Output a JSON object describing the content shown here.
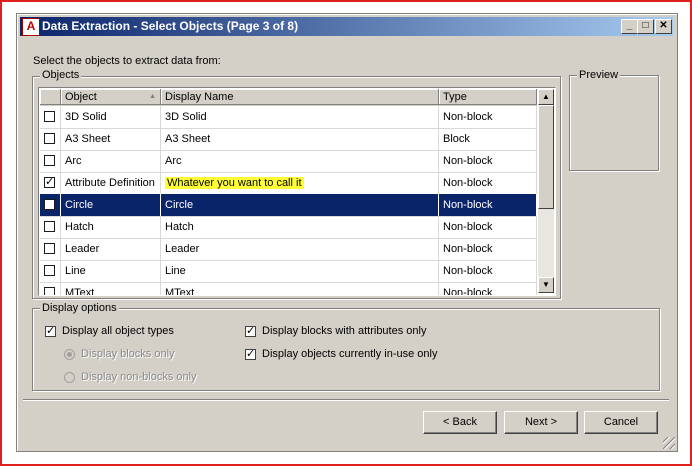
{
  "window": {
    "title": "Data Extraction - Select Objects (Page 3 of 8)",
    "app_icon": "A",
    "minimize_glyph": "_",
    "maximize_glyph": "□",
    "close_glyph": "✕"
  },
  "instruction": "Select the objects to extract data from:",
  "objects_group": {
    "legend": "Objects",
    "columns": [
      "Object",
      "Display Name",
      "Type"
    ],
    "sort_indicator": "▲",
    "rows": [
      {
        "checked": false,
        "object": "3D Solid",
        "display_name": "3D Solid",
        "type": "Non-block"
      },
      {
        "checked": false,
        "object": "A3 Sheet",
        "display_name": "A3 Sheet",
        "type": "Block"
      },
      {
        "checked": false,
        "object": "Arc",
        "display_name": "Arc",
        "type": "Non-block"
      },
      {
        "checked": true,
        "object": "Attribute Definition",
        "display_name": "Whatever you want to call it",
        "type": "Non-block"
      },
      {
        "checked": false,
        "object": "Circle",
        "display_name": "Circle",
        "type": "Non-block"
      },
      {
        "checked": false,
        "object": "Hatch",
        "display_name": "Hatch",
        "type": "Non-block"
      },
      {
        "checked": false,
        "object": "Leader",
        "display_name": "Leader",
        "type": "Non-block"
      },
      {
        "checked": false,
        "object": "Line",
        "display_name": "Line",
        "type": "Non-block"
      },
      {
        "checked": false,
        "object": "MText",
        "display_name": "MText",
        "type": "Non-block"
      }
    ],
    "selected_row": "Circle",
    "highlighted_cell": "Whatever you want to call it",
    "highlight_color": "#ffff33",
    "selection_color": "#0a246a"
  },
  "preview": {
    "legend": "Preview"
  },
  "display_options": {
    "legend": "Display options",
    "display_all_types": {
      "label": "Display all object types",
      "checked": true
    },
    "blocks_only": {
      "label": "Display blocks only",
      "selected": true,
      "enabled": false
    },
    "non_blocks_only": {
      "label": "Display non-blocks only",
      "selected": false,
      "enabled": false
    },
    "blocks_with_attributes": {
      "label": "Display blocks with attributes only",
      "checked": true
    },
    "objects_in_use": {
      "label": "Display objects currently in-use only",
      "checked": true
    }
  },
  "buttons": {
    "back": "< Back",
    "next": "Next >",
    "cancel": "Cancel"
  },
  "icons": {
    "check": "✓",
    "scroll_up": "▲",
    "scroll_down": "▼"
  }
}
